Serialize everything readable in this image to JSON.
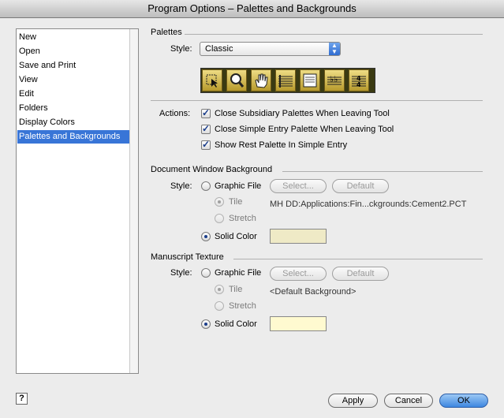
{
  "window": {
    "title": "Program Options – Palettes and Backgrounds"
  },
  "sidebar": {
    "items": [
      {
        "label": "New"
      },
      {
        "label": "Open"
      },
      {
        "label": "Save and Print"
      },
      {
        "label": "View"
      },
      {
        "label": "Edit"
      },
      {
        "label": "Folders"
      },
      {
        "label": "Display Colors"
      },
      {
        "label": "Palettes and Backgrounds"
      }
    ],
    "selected_index": 7
  },
  "palettes": {
    "section_label": "Palettes",
    "style_label": "Style:",
    "style_value": "Classic",
    "tools": [
      "selection-tool-icon",
      "zoom-tool-icon",
      "hand-grabber-icon",
      "staff-tool-icon",
      "page-layout-icon",
      "key-signature-icon",
      "time-signature-icon"
    ]
  },
  "actions": {
    "label": "Actions:",
    "options": [
      {
        "label": "Close Subsidiary Palettes When Leaving Tool",
        "checked": true
      },
      {
        "label": "Close Simple Entry Palette When Leaving Tool",
        "checked": true
      },
      {
        "label": "Show Rest Palette In Simple Entry",
        "checked": true
      }
    ]
  },
  "doc_background": {
    "section_label": "Document Window Background",
    "style_label": "Style:",
    "graphic_file_label": "Graphic File",
    "select_label": "Select...",
    "default_label": "Default",
    "tile_label": "Tile",
    "stretch_label": "Stretch",
    "path": "MH DD:Applications:Fin...ckgrounds:Cement2.PCT",
    "solid_color_label": "Solid Color",
    "selected": "Solid Color",
    "color": "#efeac6"
  },
  "manuscript": {
    "section_label": "Manuscript Texture",
    "style_label": "Style:",
    "graphic_file_label": "Graphic File",
    "select_label": "Select...",
    "default_label": "Default",
    "tile_label": "Tile",
    "stretch_label": "Stretch",
    "path": "<Default Background>",
    "solid_color_label": "Solid Color",
    "selected": "Solid Color",
    "color": "#fffad0"
  },
  "footer": {
    "help": "?",
    "apply": "Apply",
    "cancel": "Cancel",
    "ok": "OK"
  }
}
